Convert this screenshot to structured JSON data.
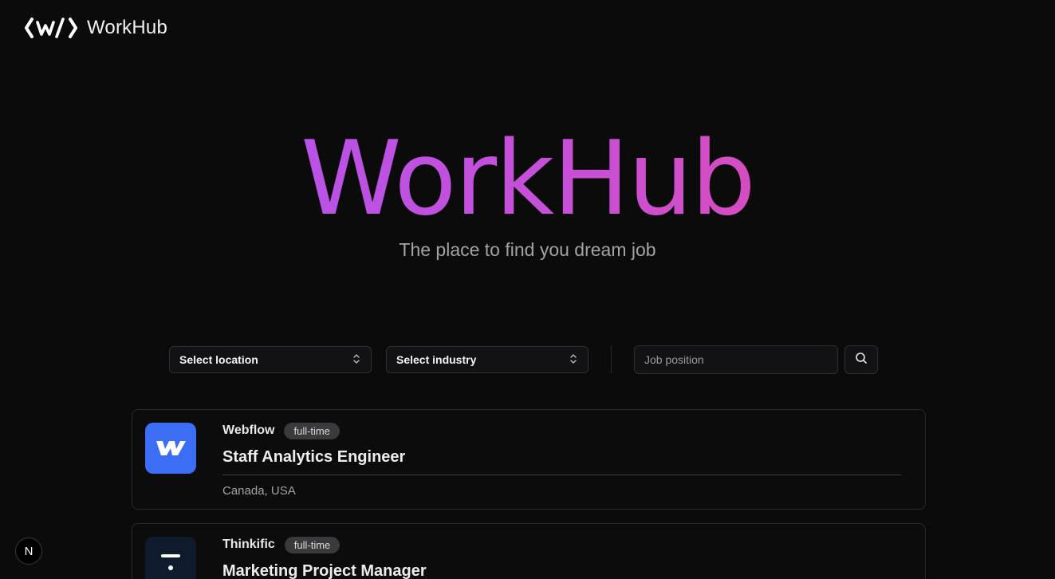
{
  "header": {
    "brand_name": "WorkHub",
    "logo_icon": "workhub-logo-icon"
  },
  "hero": {
    "title": "WorkHub",
    "subtitle": "The place to find you dream job",
    "gradient": [
      "#a855f7",
      "#ec4899"
    ]
  },
  "filters": {
    "location_label": "Select location",
    "industry_label": "Select industry",
    "job_position_placeholder": "Job position",
    "job_position_value": ""
  },
  "jobs": [
    {
      "company": "Webflow",
      "type": "full-time",
      "title": "Staff Analytics Engineer",
      "location": "Canada, USA",
      "logo_color": "#3b6ef5"
    },
    {
      "company": "Thinkific",
      "type": "full-time",
      "title": "Marketing Project Manager",
      "location": "",
      "logo_color": "#0f1b2d"
    }
  ],
  "dev_indicator": {
    "label": "N"
  }
}
